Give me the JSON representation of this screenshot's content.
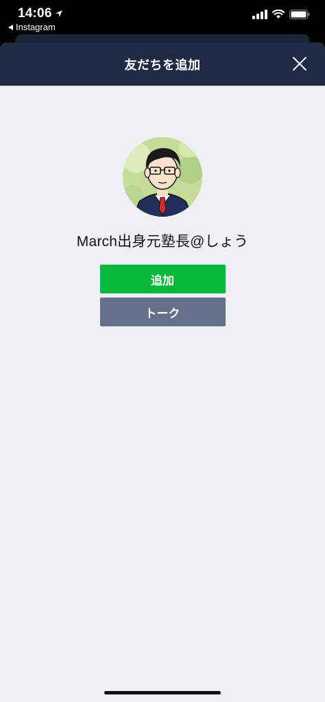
{
  "status_bar": {
    "time": "14:06",
    "back_app": "Instagram"
  },
  "header": {
    "title": "友だちを追加"
  },
  "profile": {
    "name": "March出身元塾長@しょう"
  },
  "buttons": {
    "add_label": "追加",
    "talk_label": "トーク"
  },
  "colors": {
    "header_bg": "#1f2a44",
    "sheet_bg": "#efeff4",
    "add_button": "#08b83a",
    "talk_button": "#646f89"
  },
  "icons": {
    "close": "close-icon",
    "location": "location-arrow-icon",
    "signal": "cellular-signal-icon",
    "wifi": "wifi-icon",
    "battery": "battery-icon"
  }
}
